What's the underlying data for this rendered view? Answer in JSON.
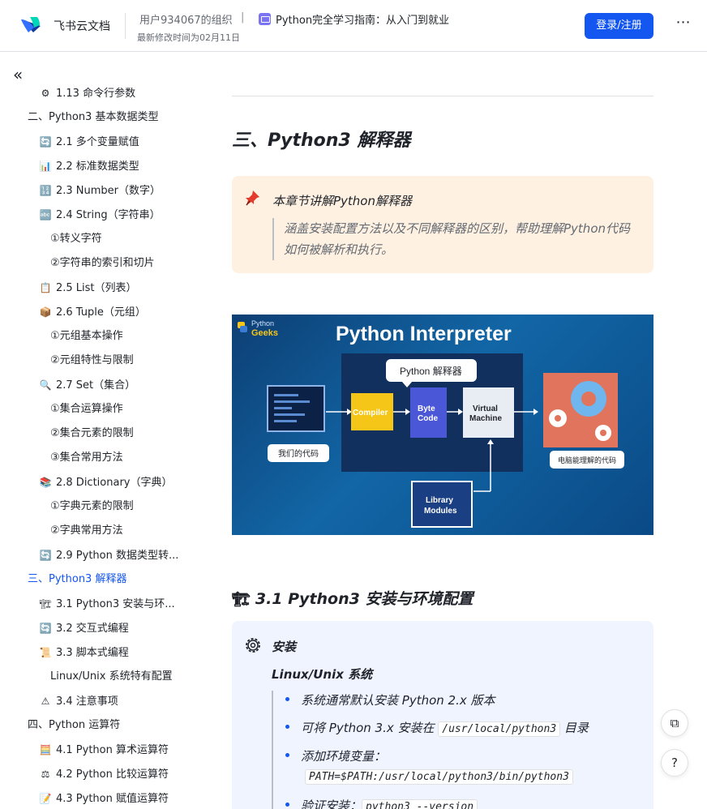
{
  "header": {
    "brand": "飞书云文档",
    "org": "用户934067的组织",
    "crumb_sep": "|",
    "doc_title": "Python完全学习指南：从入门到就业",
    "modified": "最新修改时间为02月11日",
    "login_label": "登录/注册",
    "more_label": "⋯"
  },
  "sidebar": {
    "collapse_label": "«",
    "items": [
      {
        "label": "1.13 命令行参数",
        "emoji": "⚙",
        "indent": 2
      },
      {
        "label": "二、Python3 基本数据类型",
        "emoji": "",
        "indent": 1
      },
      {
        "label": "2.1 多个变量赋值",
        "emoji": "🔄",
        "indent": 2
      },
      {
        "label": "2.2 标准数据类型",
        "emoji": "📊",
        "indent": 2
      },
      {
        "label": "2.3 Number（数字）",
        "emoji": "🔢",
        "indent": 2
      },
      {
        "label": "2.4 String（字符串）",
        "emoji": "🔤",
        "indent": 2
      },
      {
        "label": "①转义字符",
        "emoji": "",
        "indent": 3
      },
      {
        "label": "②字符串的索引和切片",
        "emoji": "",
        "indent": 3
      },
      {
        "label": "2.5 List（列表）",
        "emoji": "📋",
        "indent": 2
      },
      {
        "label": "2.6 Tuple（元组）",
        "emoji": "📦",
        "indent": 2
      },
      {
        "label": "①元组基本操作",
        "emoji": "",
        "indent": 3
      },
      {
        "label": "②元组特性与限制",
        "emoji": "",
        "indent": 3
      },
      {
        "label": "2.7 Set（集合）",
        "emoji": "🔍",
        "indent": 2
      },
      {
        "label": "①集合运算操作",
        "emoji": "",
        "indent": 3
      },
      {
        "label": "②集合元素的限制",
        "emoji": "",
        "indent": 3
      },
      {
        "label": "③集合常用方法",
        "emoji": "",
        "indent": 3
      },
      {
        "label": "2.8 Dictionary（字典）",
        "emoji": "📚",
        "indent": 2
      },
      {
        "label": "①字典元素的限制",
        "emoji": "",
        "indent": 3
      },
      {
        "label": "②字典常用方法",
        "emoji": "",
        "indent": 3
      },
      {
        "label": "2.9 Python 数据类型转...",
        "emoji": "🔄",
        "indent": 2
      },
      {
        "label": "三、Python3 解释器",
        "emoji": "",
        "indent": 1,
        "active": true
      },
      {
        "label": "3.1 Python3 安装与环...",
        "emoji": "🏗",
        "indent": 2
      },
      {
        "label": "3.2 交互式编程",
        "emoji": "🔄",
        "indent": 2
      },
      {
        "label": "3.3 脚本式编程",
        "emoji": "📜",
        "indent": 2
      },
      {
        "label": "Linux/Unix 系统特有配置",
        "emoji": "",
        "indent": 3
      },
      {
        "label": "3.4 注意事项",
        "emoji": "⚠",
        "indent": 2
      },
      {
        "label": "四、Python 运算符",
        "emoji": "",
        "indent": 1
      },
      {
        "label": "4.1 Python 算术运算符",
        "emoji": "🧮",
        "indent": 2
      },
      {
        "label": "4.2 Python 比较运算符",
        "emoji": "⚖",
        "indent": 2
      },
      {
        "label": "4.3 Python 赋值运算符",
        "emoji": "📝",
        "indent": 2
      }
    ]
  },
  "main": {
    "h2": "三、Python3 解释器",
    "callout": {
      "icon": "pushpin-icon",
      "title": "本章节讲解Python解释器",
      "text": "涵盖安装配置方法以及不同解释器的区别，帮助理解Python代码如何被解析和执行。"
    },
    "diagram": {
      "brand_line1": "Python",
      "brand_line2": "Geeks",
      "title": "Python Interpreter",
      "bubble": "Python 解释器",
      "code_label": "我们的代码",
      "compiler": "Compiler",
      "bytecode_1": "Byte",
      "bytecode_2": "Code",
      "vm_1": "Virtual",
      "vm_2": "Machine",
      "library_1": "Library",
      "library_2": "Modules",
      "output_label": "电脑能理解的代码"
    },
    "h3": {
      "emoji": "🏗",
      "text": "3.1 Python3 安装与环境配置"
    },
    "infobox": {
      "title": "安装",
      "subtitle": "Linux/Unix 系统",
      "bullets": [
        {
          "text": "系统通常默认安装 Python 2.x 版本"
        },
        {
          "pre": "可将 Python 3.x 安装在 ",
          "code": "/usr/local/python3",
          "post": " 目录"
        },
        {
          "pre": "添加环境变量："
        },
        {
          "code": "PATH=$PATH:/usr/local/python3/bin/python3"
        },
        {
          "pre": "验证安装：",
          "code": "python3 --version"
        }
      ]
    }
  },
  "floating": {
    "doc_btn": "⧉",
    "help_btn": "?"
  },
  "colors": {
    "accent": "#1456f0",
    "callout_bg": "#fef1e1",
    "infobox_bg": "#f0f4ff"
  }
}
